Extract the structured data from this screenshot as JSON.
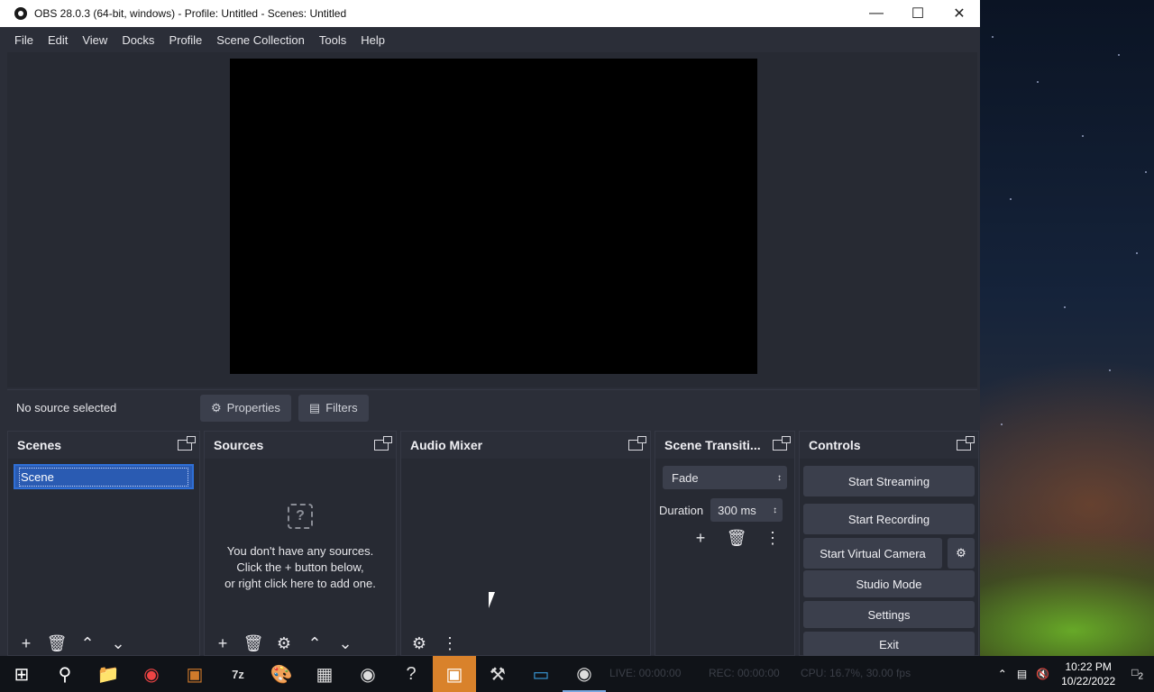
{
  "window": {
    "title": "OBS 28.0.3 (64-bit, windows) - Profile: Untitled - Scenes: Untitled"
  },
  "menu": [
    "File",
    "Edit",
    "View",
    "Docks",
    "Profile",
    "Scene Collection",
    "Tools",
    "Help"
  ],
  "context_bar": {
    "no_source": "No source selected",
    "properties": "Properties",
    "filters": "Filters"
  },
  "docks": {
    "scenes": {
      "title": "Scenes",
      "items": [
        "Scene"
      ]
    },
    "sources": {
      "title": "Sources",
      "empty_line1": "You don't have any sources.",
      "empty_line2": "Click the + button below,",
      "empty_line3": "or right click here to add one."
    },
    "audio_mixer": {
      "title": "Audio Mixer"
    },
    "scene_transitions": {
      "title": "Scene Transiti...",
      "transition": "Fade",
      "duration_label": "Duration",
      "duration_value": "300 ms"
    },
    "controls": {
      "title": "Controls",
      "start_streaming": "Start Streaming",
      "start_recording": "Start Recording",
      "start_virtual_camera": "Start Virtual Camera",
      "studio_mode": "Studio Mode",
      "settings": "Settings",
      "exit": "Exit"
    }
  },
  "statusbar_ghost": {
    "live": "LIVE: 00:00:00",
    "rec": "REC: 00:00:00",
    "cpu": "CPU: 16.7%, 30.00 fps"
  },
  "taskbar": {
    "time": "10:22 PM",
    "date": "10/22/2022",
    "notifications": "2"
  },
  "icons": {
    "start": "windows-logo-icon",
    "search": "search-icon",
    "explorer": "folder-icon",
    "chrome": "chrome-icon",
    "obs": "obs-icon"
  }
}
